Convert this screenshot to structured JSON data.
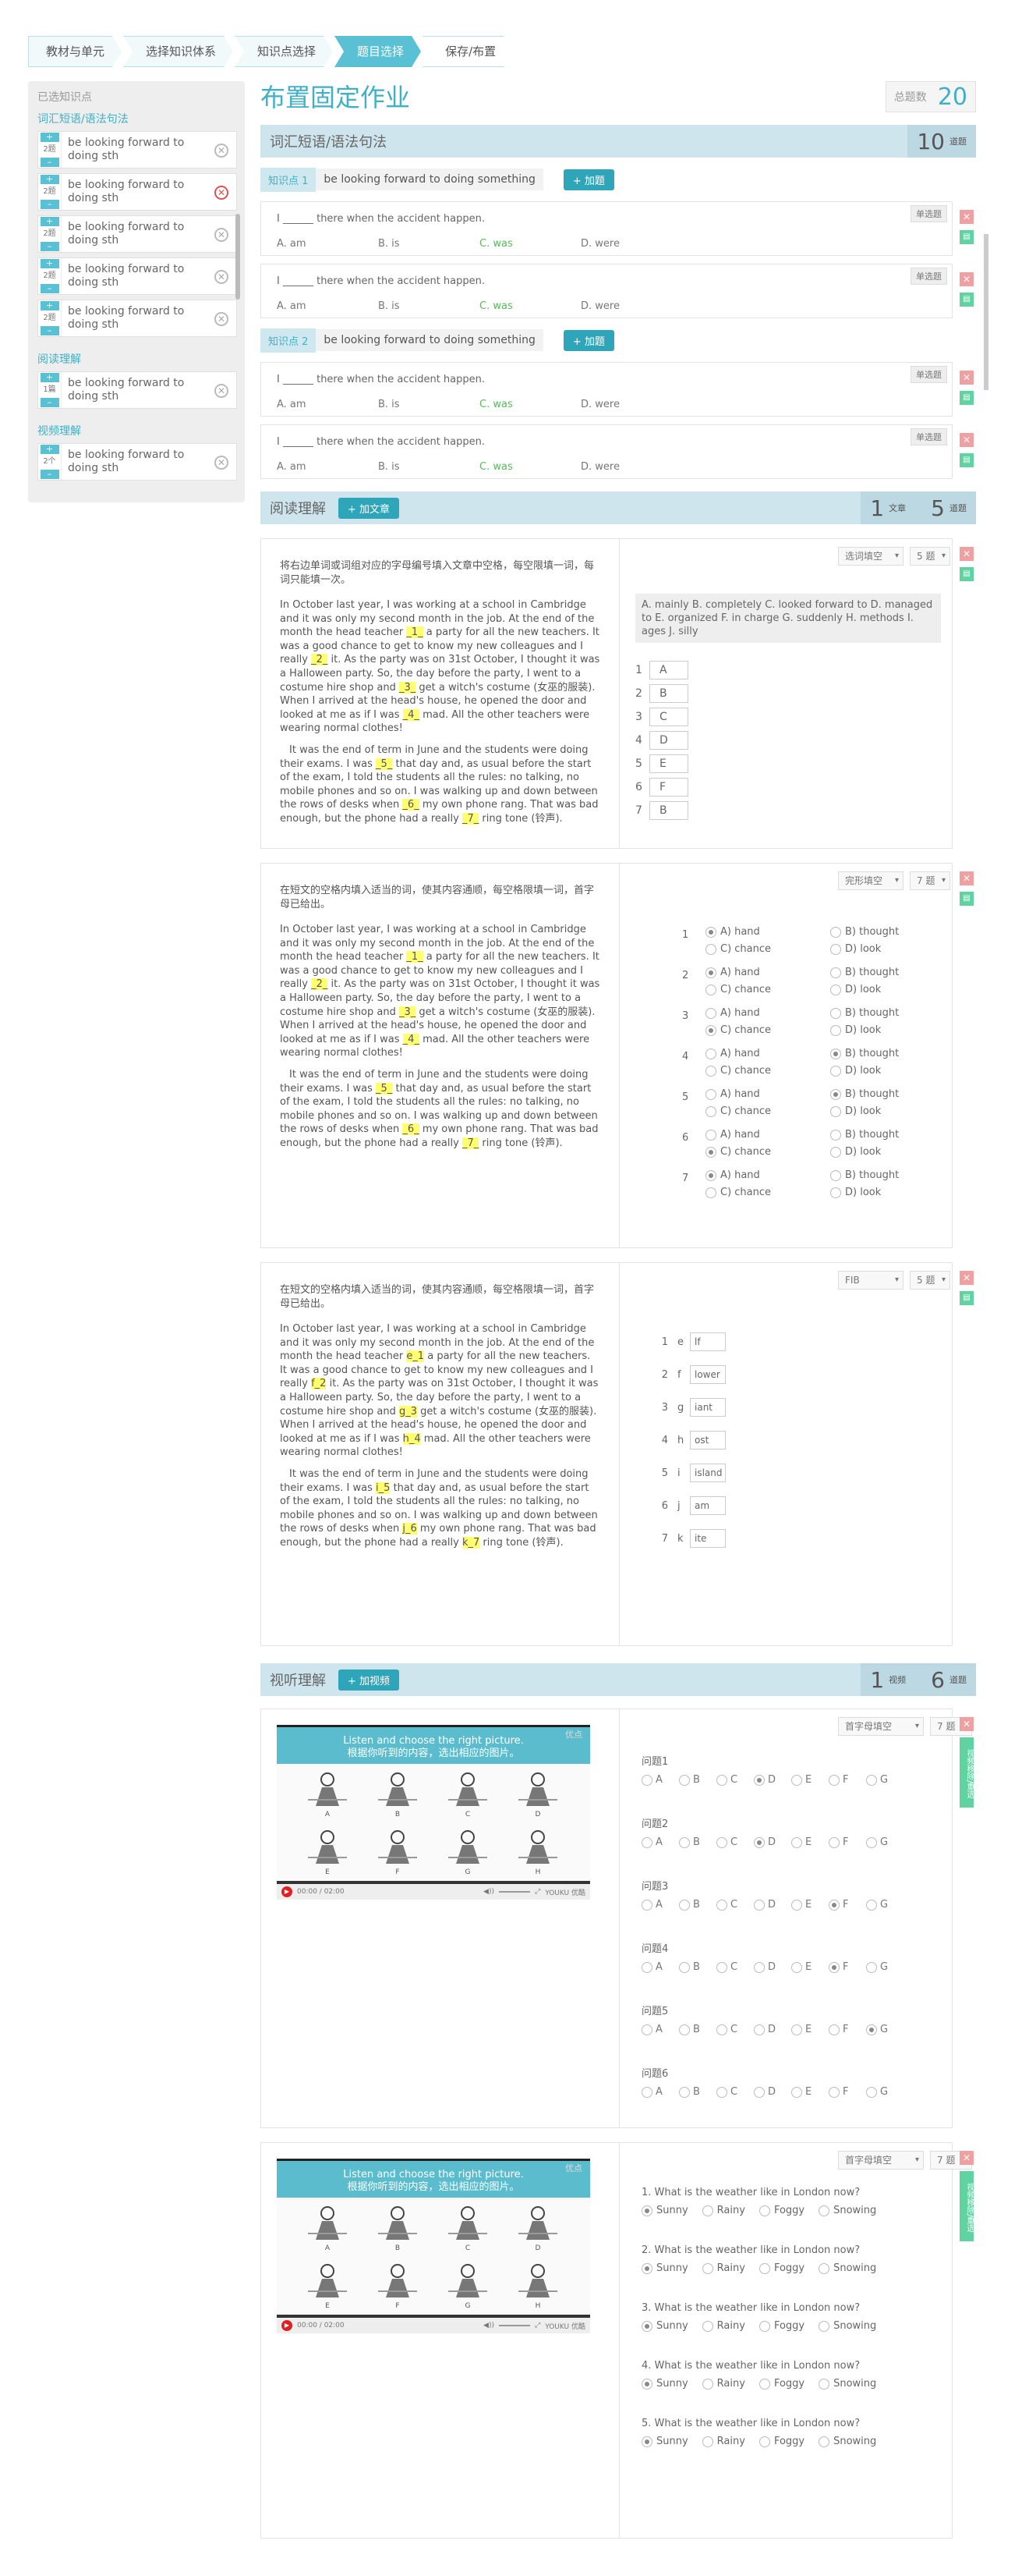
{
  "breadcrumbs": [
    "教材与单元",
    "选择知识体系",
    "知识点选择",
    "题目选择",
    "保存/布置"
  ],
  "sidebar": {
    "header": "已选知识点",
    "sections": [
      {
        "title": "词汇短语/语法句法",
        "items": [
          {
            "count": "2题",
            "label": "be looking forward to doing sth",
            "remove": "normal"
          },
          {
            "count": "2题",
            "label": "be looking forward to doing sth",
            "remove": "red"
          },
          {
            "count": "2题",
            "label": "be looking forward to doing sth",
            "remove": "normal"
          },
          {
            "count": "2题",
            "label": "be looking forward to doing sth",
            "remove": "normal"
          },
          {
            "count": "2题",
            "label": "be looking forward to doing sth",
            "remove": "normal"
          }
        ]
      },
      {
        "title": "阅读理解",
        "items": [
          {
            "count": "1篇",
            "label": "be looking forward to doing sth",
            "remove": "normal"
          }
        ]
      },
      {
        "title": "视频理解",
        "items": [
          {
            "count": "2个",
            "label": "be looking forward to doing sth",
            "remove": "normal"
          }
        ]
      }
    ]
  },
  "page": {
    "title": "布置固定作业",
    "total_label": "总题数",
    "total_value": "20"
  },
  "vocab": {
    "title": "词汇短语/语法句法",
    "count": "10",
    "count_unit": "道题",
    "points": [
      {
        "tag": "知识点 1",
        "text": "be looking forward to doing something",
        "add": "+ 加题"
      },
      {
        "tag": "知识点 2",
        "text": "be looking forward to doing something",
        "add": "+ 加题"
      }
    ],
    "question": {
      "text": "I ______ there when the accident happen.",
      "opts": [
        "A. am",
        "B. is",
        "C. was",
        "D. were"
      ],
      "type": "单选题"
    }
  },
  "reading": {
    "title": "阅读理解",
    "add": "+ 加文章",
    "articles": "1",
    "articles_unit": "文章",
    "questions": "5",
    "questions_unit": "道题",
    "p1_prefix": "In October last year, I was working at a school in Cambridge and it was only my second month in the job. At the end of the month the head teacher",
    "p1_mid": "a party for all the new teachers. It was a good chance to get to know my new colleagues and I really",
    "p1_mid2": "it. As the party was on 31st October, I thought it was a Halloween party. So, the day before the party, I went to a costume hire shop and",
    "p1_mid3": "get a witch's costume (女巫的服装). When I arrived at the head's house, he opened the door and looked at me as if I was",
    "p1_end": "mad. All the other teachers were wearing normal clothes!",
    "p2_prefix": "It was the end of term in June and the students were doing their exams. I was",
    "p2_mid": "that day and, as usual before the start of the exam, I told the students all the rules: no talking, no mobile phones and so on. I was walking up and down between the rows of desks when",
    "p2_mid2": "my own phone rang. That was bad enough, but the phone had a really",
    "p2_end": "ring tone (铃声).",
    "card1": {
      "instr": "将右边单词或词组对应的字母编号填入文章中空格，每空限填一词，每词只能填一次。",
      "type": "选词填空",
      "count": "5 题",
      "bank": "A. mainly  B. completely  C. looked forward to  D. managed to  E. organized  F. in charge  G. suddenly  H. methods  I. ages  J. silly",
      "blanks": [
        "1",
        "2",
        "3",
        "4",
        "5",
        "6",
        "7"
      ],
      "answers": [
        "A",
        "B",
        "C",
        "D",
        "E",
        "F",
        "B"
      ]
    },
    "card2": {
      "instr": "在短文的空格内填入适当的词，使其内容通顺，每空格限填一词，首字母已给出。",
      "type": "完形填空",
      "count": "7 题",
      "labels": [
        "A) hand",
        "B) thought",
        "C) chance",
        "D) look"
      ],
      "selected": [
        "A",
        "A",
        "C",
        "B",
        "B",
        "C",
        "A"
      ]
    },
    "card3": {
      "instr": "在短文的空格内填入适当的词，使其内容通顺，每空格限填一词，首字母已给出。",
      "type": "FIB",
      "count": "5 题",
      "blanks": [
        "e",
        "f",
        "g",
        "h",
        "i",
        "j",
        "k"
      ],
      "hl": [
        "e_1",
        "f_2",
        "g_3",
        "h_4",
        "i_5",
        "j_6",
        "k_7"
      ],
      "answers": [
        "lf",
        "lower",
        "iant",
        "ost",
        "island",
        "am",
        "ite"
      ]
    }
  },
  "video": {
    "title": "视听理解",
    "add": "+ 加视频",
    "videos": "1",
    "videos_unit": "视频",
    "questions": "6",
    "questions_unit": "道题",
    "player": {
      "head1": "Listen and choose the right picture.",
      "head2": "根据你听到的内容，选出相应的图片。",
      "watermark": "优点",
      "time": "00:00 / 02:00",
      "brand": "YOUKU 优酷"
    },
    "card1": {
      "type": "首字母填空",
      "count": "7 题",
      "side": "视频移除/重选",
      "questions": [
        "问题1",
        "问题2",
        "问题3",
        "问题4",
        "问题5",
        "问题6"
      ],
      "letters": [
        "A",
        "B",
        "C",
        "D",
        "E",
        "F",
        "G"
      ],
      "selected": [
        "D",
        "D",
        "F",
        "F",
        "G",
        ""
      ]
    },
    "card2": {
      "type": "首字母填空",
      "count": "7 题",
      "side": "视频移除/重选",
      "questions": [
        "1. What is the weather like in London now?",
        "2. What is the weather like in London now?",
        "3. What is the weather like in London now?",
        "4. What is the weather like in London now?",
        "5. What is the weather like in London now?"
      ],
      "options": [
        "Sunny",
        "Rainy",
        "Foggy",
        "Snowing"
      ]
    },
    "fig_labels": [
      "A",
      "B",
      "C",
      "D",
      "E",
      "F",
      "G",
      "H"
    ]
  },
  "colors": {
    "accent": "#3fb0c5",
    "header_bar": "#cfe5ee",
    "correct": "#5cb85c",
    "remove": "#f0a0a0",
    "ok": "#5fd3a0"
  }
}
